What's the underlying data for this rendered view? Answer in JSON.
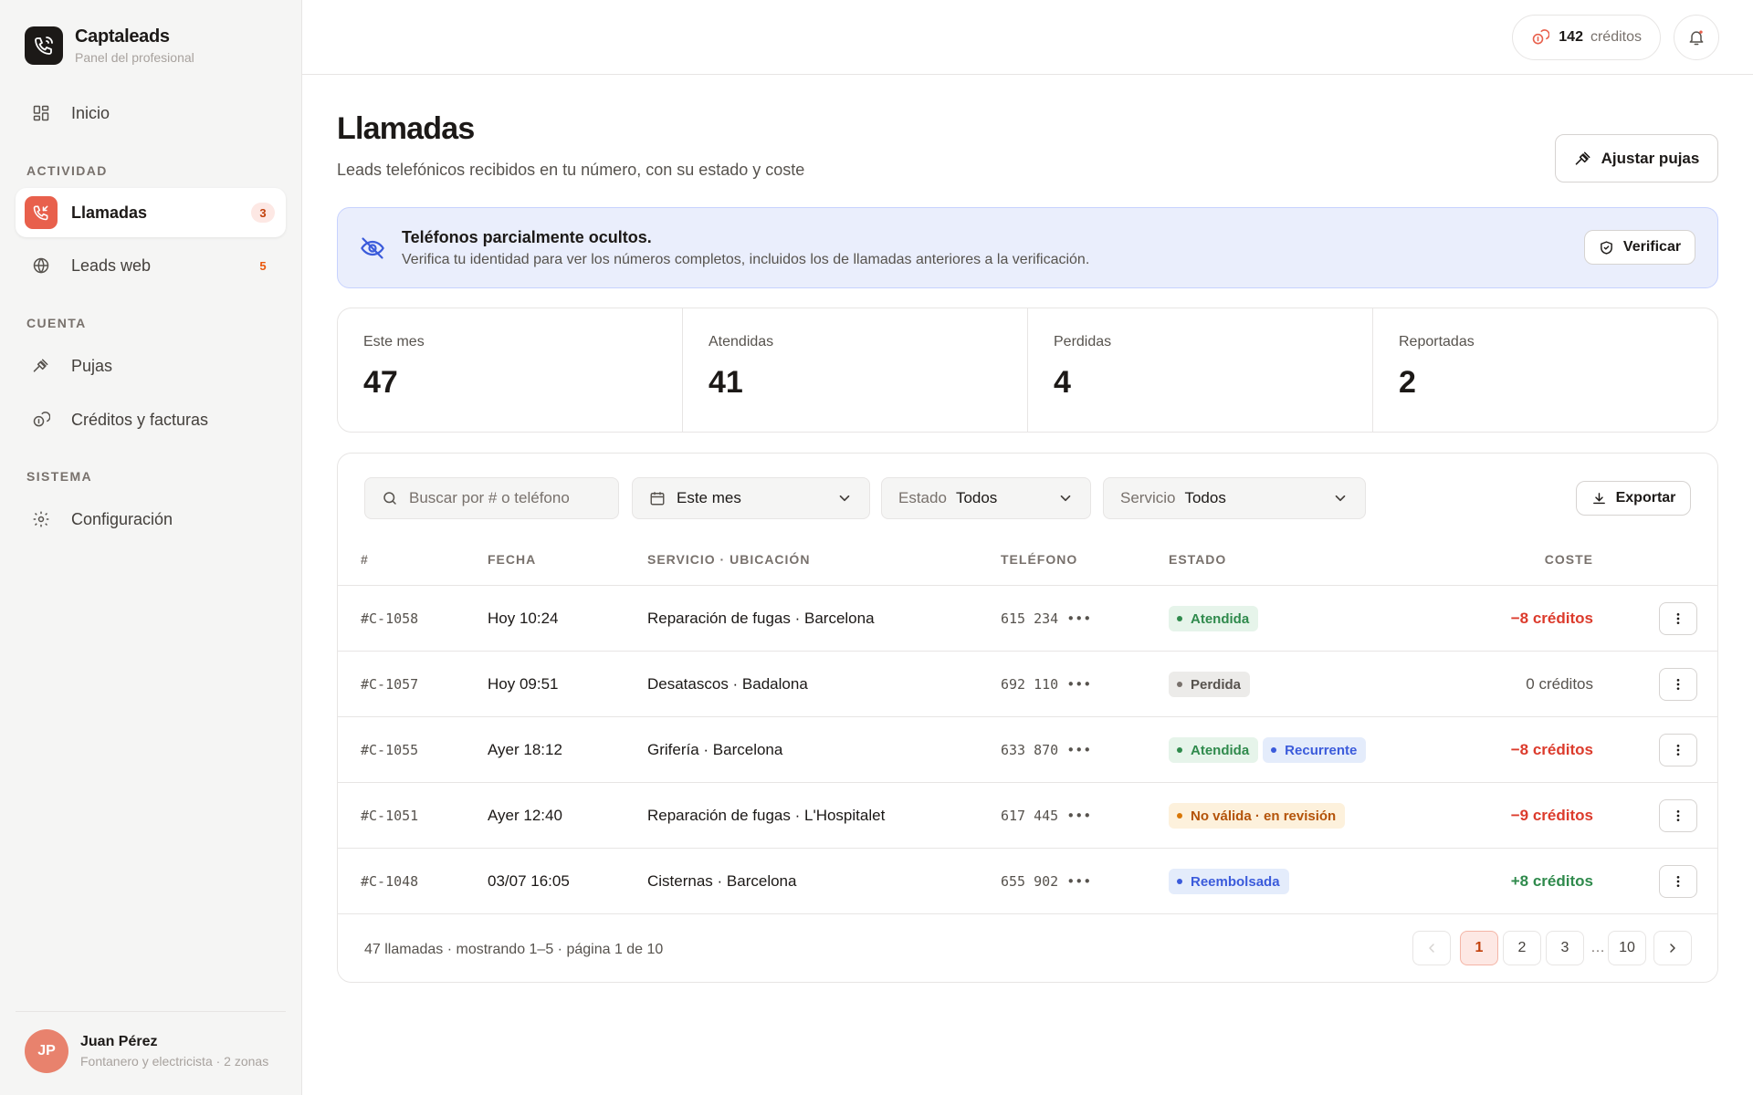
{
  "brand": {
    "name": "Captaleads",
    "subtitle": "Panel del profesional"
  },
  "sidebar": {
    "home": "Inicio",
    "sections": {
      "activity": "ACTIVIDAD",
      "account": "CUENTA",
      "system": "SISTEMA"
    },
    "items": {
      "calls": {
        "label": "Llamadas",
        "badge": "3"
      },
      "web_leads": {
        "label": "Leads web",
        "badge": "5"
      },
      "bids": {
        "label": "Pujas"
      },
      "credits": {
        "label": "Créditos y facturas"
      },
      "settings": {
        "label": "Configuración"
      }
    }
  },
  "user": {
    "initials": "JP",
    "name": "Juan Pérez",
    "subtitle": "Fontanero y electricista · 2 zonas"
  },
  "topbar": {
    "credits_value": "142",
    "credits_unit": "créditos"
  },
  "page": {
    "title": "Llamadas",
    "subtitle": "Leads telefónicos recibidos en tu número, con su estado y coste",
    "adjust_button": "Ajustar pujas"
  },
  "alert": {
    "title": "Teléfonos parcialmente ocultos.",
    "text": "Verifica tu identidad para ver los números completos, incluidos los de llamadas anteriores a la verificación.",
    "button": "Verificar"
  },
  "stats": [
    {
      "label": "Este mes",
      "value": "47"
    },
    {
      "label": "Atendidas",
      "value": "41"
    },
    {
      "label": "Perdidas",
      "value": "4"
    },
    {
      "label": "Reportadas",
      "value": "2"
    }
  ],
  "filters": {
    "search_placeholder": "Buscar por # o teléfono",
    "period": "Este mes",
    "status_label": "Estado",
    "status_value": "Todos",
    "service_label": "Servicio",
    "service_value": "Todos",
    "export": "Exportar"
  },
  "table": {
    "headers": {
      "id": "#",
      "date": "FECHA",
      "service": "SERVICIO · UBICACIÓN",
      "phone": "TELÉFONO",
      "status": "ESTADO",
      "cost": "COSTE"
    },
    "rows": [
      {
        "id": "#C-1058",
        "date": "Hoy 10:24",
        "service": "Reparación de fugas · Barcelona",
        "phone": "615 234 •••",
        "badges": [
          {
            "text": "Atendida",
            "color": "green"
          }
        ],
        "cost": "−8 créditos",
        "cost_tone": "red"
      },
      {
        "id": "#C-1057",
        "date": "Hoy 09:51",
        "service": "Desatascos · Badalona",
        "phone": "692 110 •••",
        "badges": [
          {
            "text": "Perdida",
            "color": "gray"
          }
        ],
        "cost": "0 créditos",
        "cost_tone": "muted"
      },
      {
        "id": "#C-1055",
        "date": "Ayer 18:12",
        "service": "Grifería · Barcelona",
        "phone": "633 870 •••",
        "badges": [
          {
            "text": "Atendida",
            "color": "green"
          },
          {
            "text": "Recurrente",
            "color": "blue"
          }
        ],
        "cost": "−8 créditos",
        "cost_tone": "red"
      },
      {
        "id": "#C-1051",
        "date": "Ayer 12:40",
        "service": "Reparación de fugas · L'Hospitalet",
        "phone": "617 445 •••",
        "badges": [
          {
            "text": "No válida · en revisión",
            "color": "amber"
          }
        ],
        "cost": "−9 créditos",
        "cost_tone": "red"
      },
      {
        "id": "#C-1048",
        "date": "03/07 16:05",
        "service": "Cisternas · Barcelona",
        "phone": "655 902 •••",
        "badges": [
          {
            "text": "Reembolsada",
            "color": "blue"
          }
        ],
        "cost": "+8 créditos",
        "cost_tone": "green"
      }
    ]
  },
  "pagination": {
    "summary": "47 llamadas · mostrando 1–5 · página 1 de 10",
    "pages": [
      "1",
      "2",
      "3"
    ],
    "ellipsis": "…",
    "last": "10",
    "current": "1"
  },
  "colors": {
    "accent": "#e8604c",
    "info_bg": "#eaeefc",
    "success": "#2f8a4c",
    "danger": "#dc3b2c"
  }
}
